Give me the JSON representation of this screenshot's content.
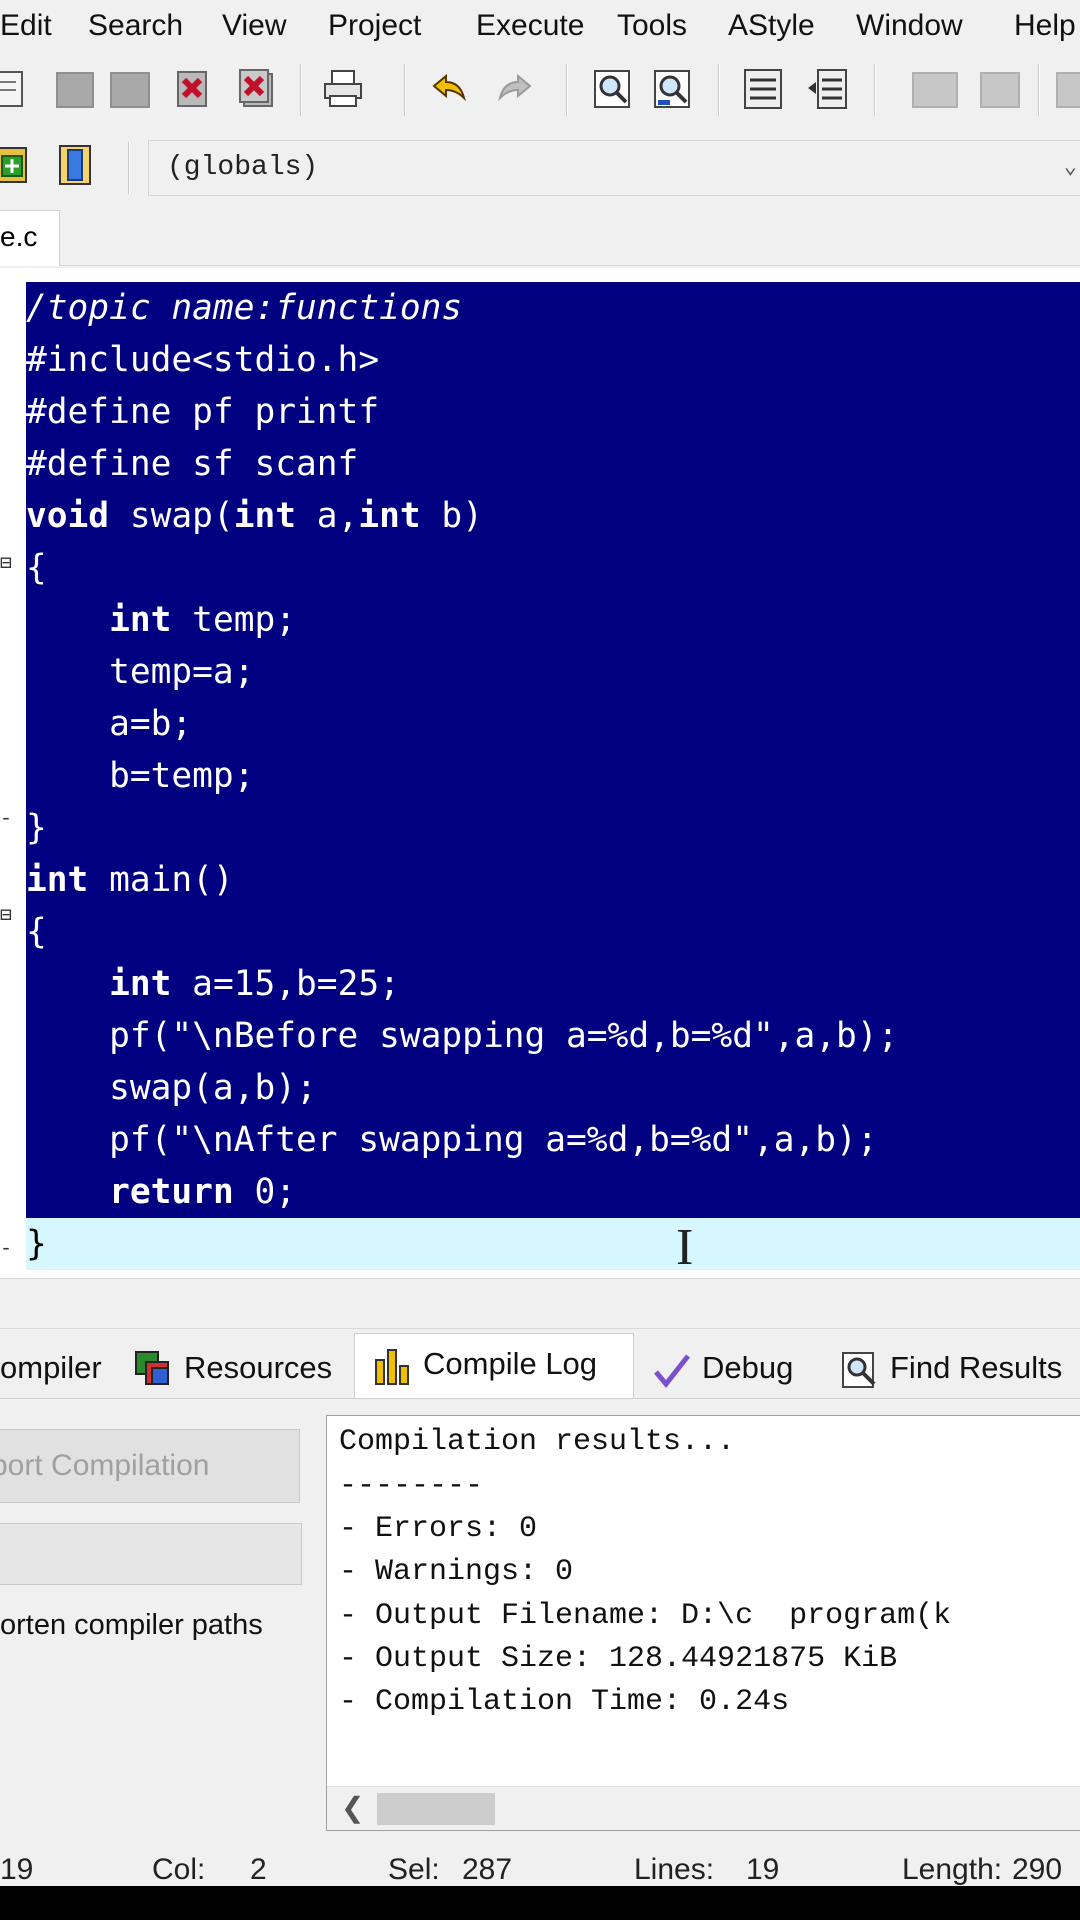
{
  "menu": [
    "Edit",
    "Search",
    "View",
    "Project",
    "Execute",
    "Tools",
    "AStyle",
    "Window",
    "Help"
  ],
  "toolbar": {
    "globals_combo": "(globals)"
  },
  "file_tab": {
    "label": "e.c"
  },
  "editor": {
    "lines": [
      "/topic name:functions",
      "#include<stdio.h>",
      "#define pf printf",
      "#define sf scanf",
      "void swap(int a,int b)",
      "{",
      "    int temp;",
      "    temp=a;",
      "    a=b;",
      "    b=temp;",
      "}",
      "int main()",
      "{",
      "    int a=15,b=25;",
      "    pf(\"\\nBefore swapping a=%d,b=%d\",a,b);",
      "    swap(a,b);",
      "    pf(\"\\nAfter swapping a=%d,b=%d\",a,b);",
      "    return 0;",
      "}"
    ],
    "selection_bg": "#000080",
    "current_line_bg": "#d6f7ff"
  },
  "bottom_tabs": [
    {
      "label": "ompiler",
      "icon": "compiler-icon"
    },
    {
      "label": "Resources",
      "icon": "resources-icon"
    },
    {
      "label": "Compile Log",
      "icon": "compile-log-icon",
      "active": true
    },
    {
      "label": "Debug",
      "icon": "debug-icon"
    },
    {
      "label": "Find Results",
      "icon": "find-results-icon"
    }
  ],
  "compile_panel": {
    "abort_button": "bort Compilation",
    "shorten_label": "orten compiler paths",
    "log": [
      "Compilation results...",
      "--------",
      "- Errors: 0",
      "- Warnings: 0",
      "- Output Filename: D:\\c  program(k",
      "- Output Size: 128.44921875 KiB",
      "- Compilation Time: 0.24s"
    ]
  },
  "status": {
    "line": "19",
    "col_label": "Col:",
    "col": "2",
    "sel_label": "Sel:",
    "sel": "287",
    "lines_label": "Lines:",
    "lines": "19",
    "length_label": "Length:",
    "length": "290"
  }
}
